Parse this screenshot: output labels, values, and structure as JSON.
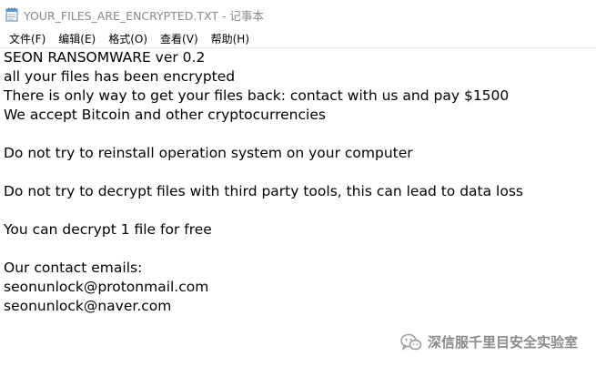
{
  "window": {
    "title": "YOUR_FILES_ARE_ENCRYPTED.TXT - 记事本",
    "icon": "notepad-icon"
  },
  "menu": [
    {
      "label": "文件(F)"
    },
    {
      "label": "编辑(E)"
    },
    {
      "label": "格式(O)"
    },
    {
      "label": "查看(V)"
    },
    {
      "label": "帮助(H)"
    }
  ],
  "document": {
    "lines": [
      "SEON RANSOMWARE ver 0.2",
      "all your files has been encrypted",
      "There is only way to get your files back: contact with us and pay $1500",
      "We accept Bitcoin and other cryptocurrencies",
      "",
      "Do not try to reinstall operation system on your computer",
      "",
      "Do not try to decrypt files with third party tools, this can lead to data loss",
      "",
      "You can decrypt 1 file for free",
      "",
      "Our contact emails:",
      "seonunlock@protonmail.com",
      "seonunlock@naver.com"
    ]
  },
  "watermark": {
    "text": "深信服千里目安全实验室",
    "icon": "wechat-icon"
  }
}
